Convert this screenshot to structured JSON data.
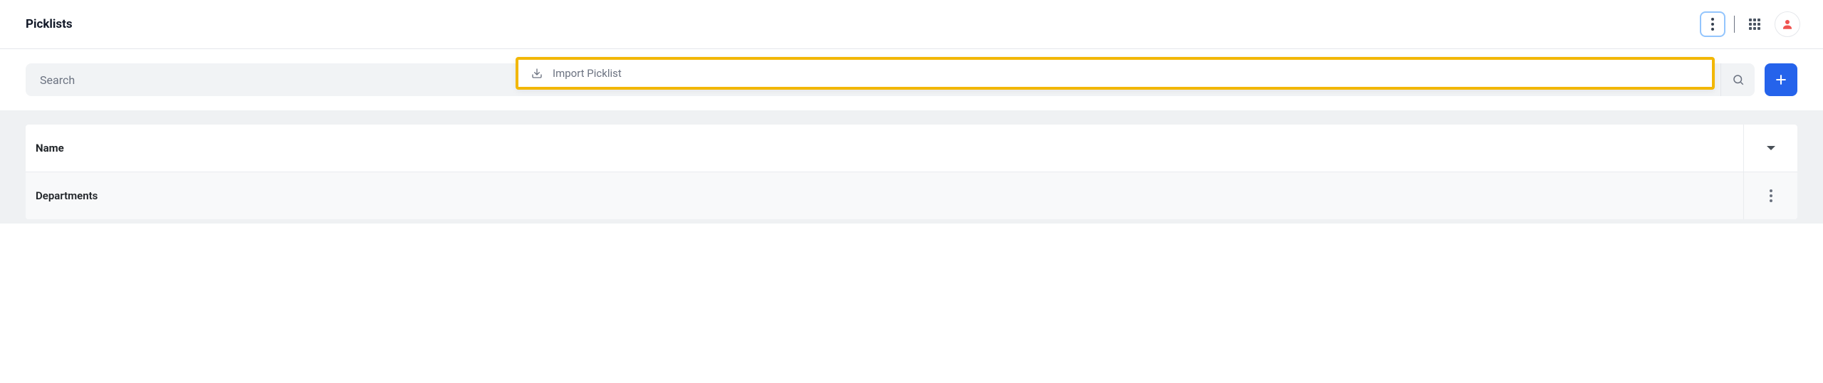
{
  "header": {
    "title": "Picklists"
  },
  "toolbar": {
    "search_placeholder": "Search"
  },
  "dropdown": {
    "import_label": "Import Picklist"
  },
  "table": {
    "columns": {
      "name": "Name"
    },
    "rows": [
      {
        "name": "Departments"
      }
    ]
  }
}
